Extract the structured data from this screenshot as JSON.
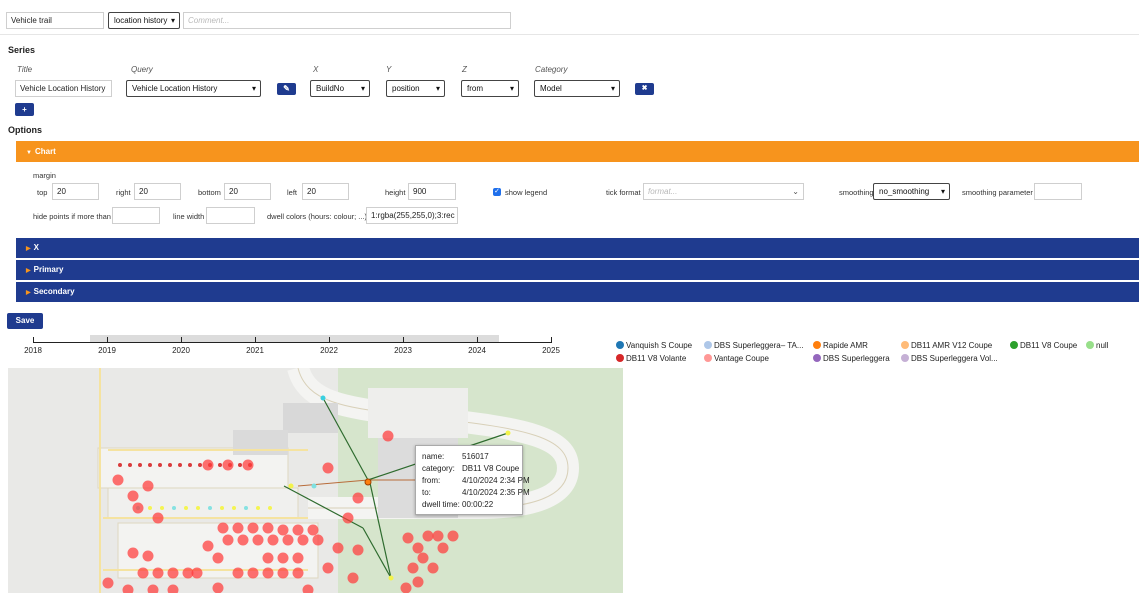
{
  "header": {
    "title_value": "Vehicle trail",
    "type_select": "location history",
    "comment_placeholder": "Comment..."
  },
  "series": {
    "section_title": "Series",
    "columns": {
      "title": "Title",
      "query": "Query",
      "x": "X",
      "y": "Y",
      "z": "Z",
      "category": "Category"
    },
    "row": {
      "title": "Vehicle Location History",
      "query": "Vehicle Location History",
      "x": "BuildNo",
      "y": "position",
      "z": "from",
      "category": "Model"
    },
    "add_label": "+",
    "remove_icon_glyph": "✖",
    "edit_icon_glyph": "✎"
  },
  "options": {
    "section_title": "Options",
    "bars": {
      "chart": "Chart",
      "x": "X",
      "primary": "Primary",
      "secondary": "Secondary"
    },
    "chart": {
      "margin_label": "margin",
      "top_label": "top",
      "top_value": "20",
      "right_label": "right",
      "right_value": "20",
      "bottom_label": "bottom",
      "bottom_value": "20",
      "left_label": "left",
      "left_value": "20",
      "height_label": "height",
      "height_value": "900",
      "show_legend_label": "show legend",
      "show_legend_checked": true,
      "tick_format_label": "tick format",
      "tick_format_placeholder": "format...",
      "smoothing_label": "smoothing",
      "smoothing_value": "no_smoothing",
      "smoothing_param_label": "smoothing parameter",
      "hide_points_label": "hide points if more than",
      "line_width_label": "line width",
      "dwell_colors_label": "dwell colors (hours: colour; ...)",
      "dwell_colors_value": "1:rgba(255,255,0);3:rec"
    }
  },
  "save_label": "Save",
  "timeline": {
    "ticks": [
      "2018",
      "2019",
      "2020",
      "2021",
      "2022",
      "2023",
      "2024",
      "2025"
    ],
    "brush_range": [
      2018.75,
      2024.25
    ]
  },
  "legend": [
    {
      "label": "Vanquish S Coupe",
      "color": "#1f77b4"
    },
    {
      "label": "DBS Superleggera– TA...",
      "color": "#aec7e8"
    },
    {
      "label": "Rapide AMR",
      "color": "#ff7f0e"
    },
    {
      "label": "DB11 AMR V12 Coupe",
      "color": "#ffbb78"
    },
    {
      "label": "DB11 V8 Coupe",
      "color": "#2ca02c"
    },
    {
      "label": "null",
      "color": "#98df8a"
    },
    {
      "label": "DB11 V8 Volante",
      "color": "#d62728"
    },
    {
      "label": "Vantage Coupe",
      "color": "#ff9896"
    },
    {
      "label": "DBS Superleggera",
      "color": "#9467bd"
    },
    {
      "label": "DBS Superleggera Vol...",
      "color": "#c5b0d5"
    }
  ],
  "tooltip": {
    "name_key": "name:",
    "name_value": "516017",
    "category_key": "category:",
    "category_value": "DB11 V8 Coupe",
    "from_key": "from:",
    "from_value": "4/10/2024 2:34 PM",
    "to_key": "to:",
    "to_value": "4/10/2024 2:35 PM",
    "dwell_key": "dwell time:",
    "dwell_value": "00:00:22"
  },
  "colors": {
    "accent_orange": "#f7941d",
    "bar_blue": "#1f3b8f",
    "map_bg": "#e8e8e6",
    "map_green": "#d5e5cb",
    "dot_red": "#ff3a3a"
  }
}
